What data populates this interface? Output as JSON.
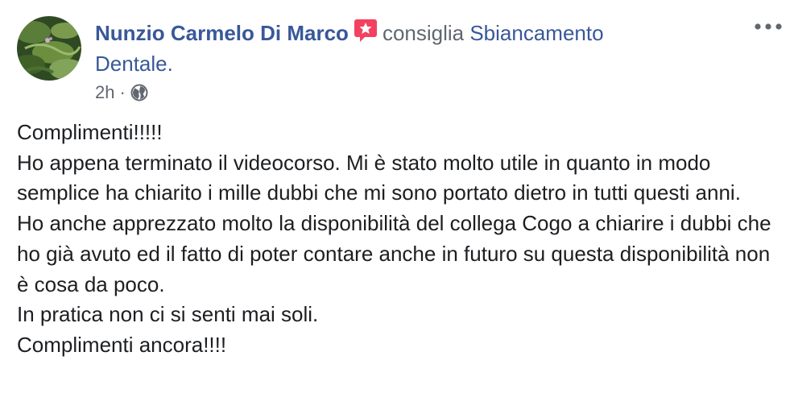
{
  "post": {
    "author_name": "Nunzio Carmelo Di Marco",
    "recommendation_badge_icon": "recommendation-star-icon",
    "recommends_verb": "consiglia",
    "page_name": "Sbiancamento Dentale.",
    "timestamp": "2h",
    "separator": "·",
    "audience_icon": "globe-icon",
    "more_icon": "more-options-icon",
    "colors": {
      "link": "#385898",
      "meta": "#606770",
      "text": "#1c1e21",
      "badge": "#f3425f"
    },
    "body_lines": [
      "Complimenti!!!!!",
      "Ho appena terminato il videocorso. Mi è stato molto utile in quanto in modo semplice ha chiarito i mille dubbi che mi sono portato dietro in tutti questi anni.",
      "Ho anche apprezzato molto la disponibilità del collega Cogo a chiarire i dubbi che ho già avuto ed il fatto di poter contare anche in futuro su questa disponibilità non è cosa da poco.",
      "In pratica non ci si senti mai soli.",
      "Complimenti ancora!!!!"
    ]
  }
}
